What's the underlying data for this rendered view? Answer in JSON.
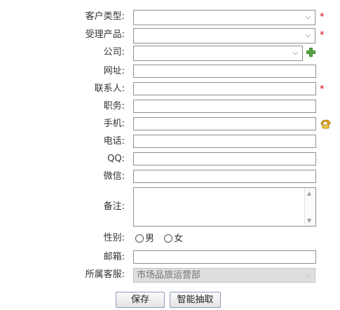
{
  "form": {
    "customer_type": {
      "label": "客户类型:",
      "value": "",
      "required": "*"
    },
    "product": {
      "label": "受理产品:",
      "value": "",
      "required": "*"
    },
    "company": {
      "label": "公司:",
      "value": ""
    },
    "website": {
      "label": "网址:",
      "value": ""
    },
    "contact": {
      "label": "联系人:",
      "value": "",
      "required": "*"
    },
    "position": {
      "label": "职务:",
      "value": ""
    },
    "mobile": {
      "label": "手机:",
      "value": ""
    },
    "phone": {
      "label": "电话:",
      "value": ""
    },
    "qq": {
      "label": "QQ:",
      "value": ""
    },
    "wechat": {
      "label": "微信:",
      "value": ""
    },
    "notes": {
      "label": "备注:",
      "value": ""
    },
    "gender": {
      "label": "性别:",
      "options": [
        "男",
        "女"
      ]
    },
    "email": {
      "label": "邮箱:",
      "value": ""
    },
    "service": {
      "label": "所属客服:",
      "value": "市场品旅运营部"
    }
  },
  "buttons": {
    "save": "保存",
    "extract": "智能抽取"
  },
  "icons": {
    "add": "plus-icon",
    "phone_lookup": "phone-icon",
    "dropdown": "chevron-down-icon"
  },
  "colors": {
    "required": "#d40000",
    "add_icon": "#58a84a"
  }
}
